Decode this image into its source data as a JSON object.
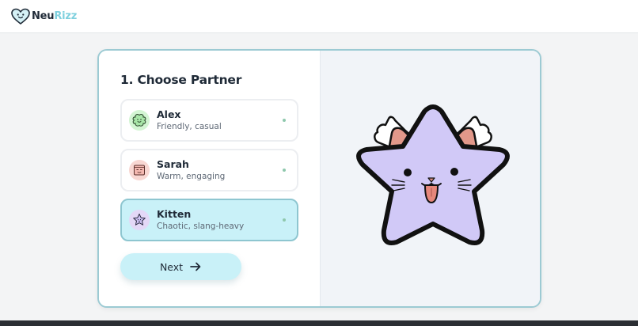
{
  "app": {
    "brand_part1": "Neu",
    "brand_part2": "Rizz",
    "brand_icon": "heart-face-icon",
    "accent_color": "#7fd0de"
  },
  "partner_step": {
    "title": "1. Choose Partner",
    "options": [
      {
        "name": "Alex",
        "description": "Friendly, casual",
        "icon": "clover-face-icon",
        "selected": false
      },
      {
        "name": "Sarah",
        "description": "Warm, engaging",
        "icon": "square-face-icon",
        "selected": false
      },
      {
        "name": "Kitten",
        "description": "Chaotic, slang-heavy",
        "icon": "star-cat-icon",
        "selected": true
      }
    ],
    "next_label": "Next",
    "next_icon": "arrow-right-icon",
    "preview_icon": "star-cat-mascot",
    "selected_color": "#c9f1f8"
  }
}
